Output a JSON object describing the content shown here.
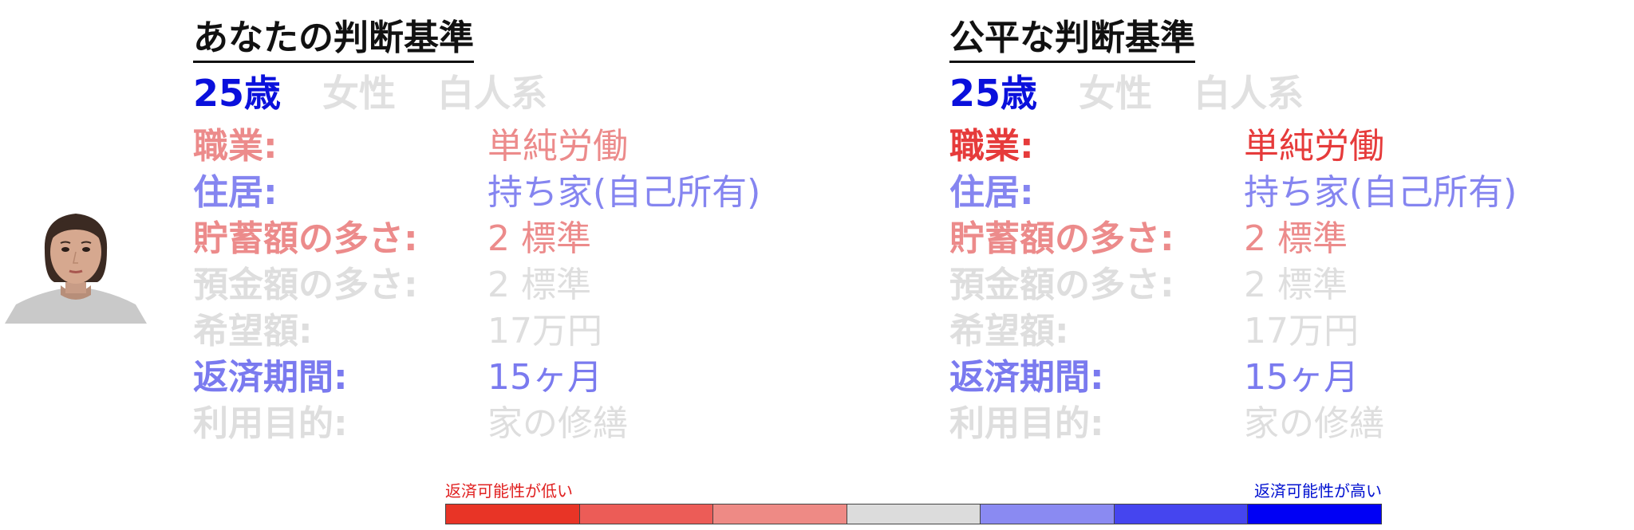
{
  "colors": {
    "strong_red": "#e83a3a",
    "soft_red": "#ec8b8b",
    "strong_blue": "#0000e0",
    "soft_blue": "#8585f0",
    "gray": "#d9d9d9",
    "scale": [
      "#e83426",
      "#ec5c57",
      "#ee8a85",
      "#dcdcdc",
      "#8a8af2",
      "#4545ef",
      "#0000f5"
    ]
  },
  "left": {
    "title": "あなたの判断基準",
    "demographics": [
      {
        "text": "25歳",
        "color": "#0a10dc"
      },
      {
        "text": "女性",
        "color": "#e0e0e0"
      },
      {
        "text": "白人系",
        "color": "#e0e0e0"
      }
    ],
    "rows": [
      {
        "label": "職業:",
        "value": "単純労働",
        "color": "#ec8b8b"
      },
      {
        "label": "住居:",
        "value": "持ち家(自己所有)",
        "color": "#8585f0"
      },
      {
        "label": "貯蓄額の多さ:",
        "value": "2 標準",
        "color": "#ec8b8b"
      },
      {
        "label": "預金額の多さ:",
        "value": "2 標準",
        "color": "#dedede"
      },
      {
        "label": "希望額:",
        "value": "17万円",
        "color": "#dedede"
      },
      {
        "label": "返済期間:",
        "value": "15ヶ月",
        "color": "#7a7aef"
      },
      {
        "label": "利用目的:",
        "value": "家の修繕",
        "color": "#dedede"
      }
    ]
  },
  "right": {
    "title": "公平な判断基準",
    "demographics": [
      {
        "text": "25歳",
        "color": "#0a10dc"
      },
      {
        "text": "女性",
        "color": "#e0e0e0"
      },
      {
        "text": "白人系",
        "color": "#e0e0e0"
      }
    ],
    "rows": [
      {
        "label": "職業:",
        "value": "単純労働",
        "color": "#e63b3b"
      },
      {
        "label": "住居:",
        "value": "持ち家(自己所有)",
        "color": "#8585f0"
      },
      {
        "label": "貯蓄額の多さ:",
        "value": "2 標準",
        "color": "#ec8b8b"
      },
      {
        "label": "預金額の多さ:",
        "value": "2 標準",
        "color": "#dedede"
      },
      {
        "label": "希望額:",
        "value": "17万円",
        "color": "#dedede"
      },
      {
        "label": "返済期間:",
        "value": "15ヶ月",
        "color": "#7a7aef"
      },
      {
        "label": "利用目的:",
        "value": "家の修繕",
        "color": "#dedede"
      }
    ]
  },
  "scale": {
    "low_label": "返済可能性が低い",
    "high_label": "返済可能性が高い"
  }
}
